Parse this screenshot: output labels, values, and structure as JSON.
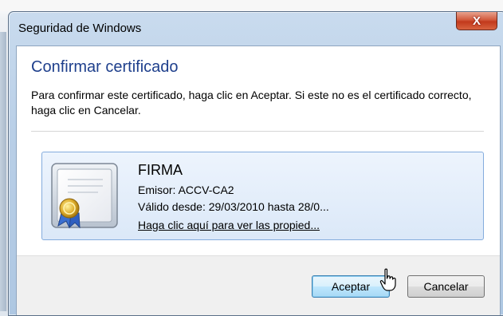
{
  "window": {
    "title": "Seguridad de Windows",
    "close_label": "X"
  },
  "dialog": {
    "heading": "Confirmar certificado",
    "instruction": "Para confirmar este certificado, haga clic en Aceptar. Si este no es el certificado correcto, haga clic en Cancelar."
  },
  "certificate": {
    "icon": "certificate-icon",
    "name": "FIRMA",
    "issuer": "Emisor: ACCV-CA2",
    "validity": "Válido desde: 29/03/2010 hasta 28/0...",
    "details_link": "Haga clic aquí para ver las propied..."
  },
  "buttons": {
    "ok_label": "Aceptar",
    "cancel_label": "Cancelar"
  },
  "colors": {
    "heading": "#1e3f8c",
    "card_border": "#84acdd",
    "close_button": "#c2391c"
  }
}
